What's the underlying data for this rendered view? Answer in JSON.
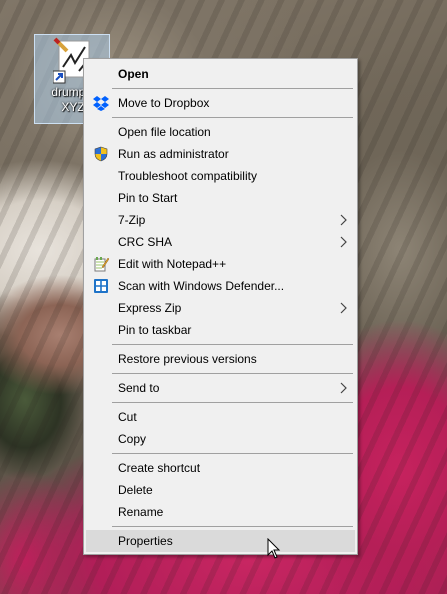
{
  "desktop": {
    "icon_label_line1": "drumplo",
    "icon_label_line2": "XYZ"
  },
  "context_menu": {
    "items": [
      {
        "label": "Open",
        "icon": null,
        "bold": true
      },
      {
        "label": "Move to Dropbox",
        "icon": "dropbox-icon"
      },
      {
        "label": "Open file location"
      },
      {
        "label": "Run as administrator",
        "icon": "uac-shield-icon"
      },
      {
        "label": "Troubleshoot compatibility"
      },
      {
        "label": "Pin to Start"
      },
      {
        "label": "7-Zip",
        "submenu": true
      },
      {
        "label": "CRC SHA",
        "submenu": true
      },
      {
        "label": "Edit with Notepad++",
        "icon": "notepadpp-icon"
      },
      {
        "label": "Scan with Windows Defender...",
        "icon": "windows-defender-icon"
      },
      {
        "label": "Express Zip",
        "submenu": true
      },
      {
        "label": "Pin to taskbar"
      },
      {
        "label": "Restore previous versions"
      },
      {
        "label": "Send to",
        "submenu": true
      },
      {
        "label": "Cut"
      },
      {
        "label": "Copy"
      },
      {
        "label": "Create shortcut"
      },
      {
        "label": "Delete"
      },
      {
        "label": "Rename"
      },
      {
        "label": "Properties",
        "highlighted": true
      }
    ]
  },
  "colors": {
    "menu_bg": "#f0f0f0",
    "menu_border": "#a0a0a0",
    "highlight": "#dadada",
    "dropbox_blue": "#0061fe"
  }
}
